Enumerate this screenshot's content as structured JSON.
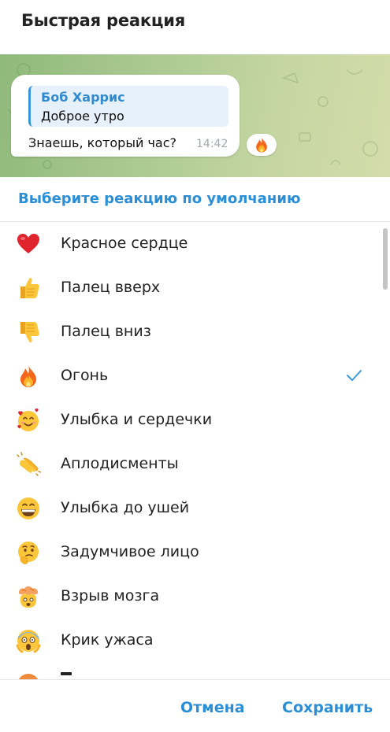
{
  "dialog": {
    "title": "Быстрая реакция"
  },
  "preview": {
    "reply_name": "Боб Харрис",
    "reply_text": "Доброе утро",
    "message_text": "Знаешь, который час?",
    "time": "14:42",
    "reaction_icon": "fire-icon"
  },
  "section_label": "Выберите реакцию по умолчанию",
  "reactions": [
    {
      "label": "Красное сердце",
      "icon": "red-heart-icon",
      "selected": false
    },
    {
      "label": "Палец вверх",
      "icon": "thumbs-up-icon",
      "selected": false
    },
    {
      "label": "Палец вниз",
      "icon": "thumbs-down-icon",
      "selected": false
    },
    {
      "label": "Огонь",
      "icon": "fire-icon",
      "selected": true
    },
    {
      "label": "Улыбка и сердечки",
      "icon": "smiling-face-with-hearts-icon",
      "selected": false
    },
    {
      "label": "Аплодисменты",
      "icon": "clapping-hands-icon",
      "selected": false
    },
    {
      "label": "Улыбка до ушей",
      "icon": "beaming-face-icon",
      "selected": false
    },
    {
      "label": "Задумчивое лицо",
      "icon": "thinking-face-icon",
      "selected": false
    },
    {
      "label": "Взрыв мозга",
      "icon": "exploding-head-icon",
      "selected": false
    },
    {
      "label": "Крик ужаса",
      "icon": "screaming-face-icon",
      "selected": false
    }
  ],
  "buttons": {
    "cancel": "Отмена",
    "save": "Сохранить"
  },
  "colors": {
    "accent": "#2a8fd6",
    "check": "#3a9ad9"
  }
}
